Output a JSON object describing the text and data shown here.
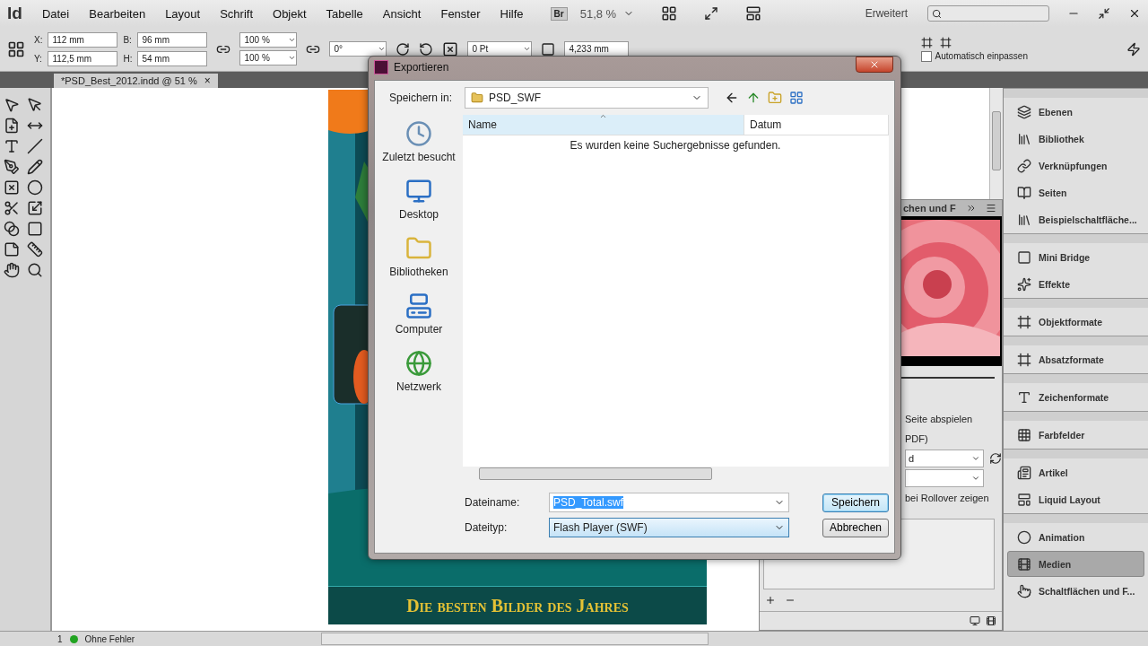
{
  "app": {
    "logo": "Id",
    "menu": [
      "Datei",
      "Bearbeiten",
      "Layout",
      "Schrift",
      "Objekt",
      "Tabelle",
      "Ansicht",
      "Fenster",
      "Hilfe"
    ],
    "bridge": "Br",
    "zoom": "51,8 %",
    "workspace": "Erweitert"
  },
  "control": {
    "fields": [
      {
        "label": "X:",
        "value": "112 mm"
      },
      {
        "label": "B:",
        "value": "96 mm"
      },
      {
        "label": "Y:",
        "value": "112,5 mm"
      },
      {
        "label": "H:",
        "value": "54 mm"
      }
    ],
    "scales": [
      "100 %",
      "100 %"
    ],
    "angle": "0°",
    "stroke": "0 Pt",
    "size": "4,233 mm",
    "autofit": {
      "label": "Automatisch einpassen",
      "checked": false
    }
  },
  "document_tab": {
    "title": "*PSD_Best_2012.indd @ 51 %",
    "close": "×"
  },
  "page": {
    "banner": "Die besten Bilder des Jahres"
  },
  "media_panel": {
    "tab": "chen und F",
    "options": [
      "Seite abspielen",
      "PDF)"
    ],
    "selects": [
      "d"
    ],
    "rollover": "bei Rollover zeigen"
  },
  "panel_groups": [
    {
      "items": [
        {
          "label": "Ebenen",
          "selected": false
        },
        {
          "label": "Bibliothek",
          "selected": false
        },
        {
          "label": "Verknüpfungen",
          "selected": false
        },
        {
          "label": "Seiten",
          "selected": false
        },
        {
          "label": "Beispielschaltfläche...",
          "selected": false
        }
      ]
    },
    {
      "items": [
        {
          "label": "Mini Bridge",
          "selected": false
        },
        {
          "label": "Effekte",
          "selected": false
        }
      ]
    },
    {
      "items": [
        {
          "label": "Objektformate",
          "selected": false
        }
      ]
    },
    {
      "items": [
        {
          "label": "Absatzformate",
          "selected": false
        }
      ]
    },
    {
      "items": [
        {
          "label": "Zeichenformate",
          "selected": false
        }
      ]
    },
    {
      "items": [
        {
          "label": "Farbfelder",
          "selected": false
        }
      ]
    },
    {
      "items": [
        {
          "label": "Artikel",
          "selected": false
        },
        {
          "label": "Liquid Layout",
          "selected": false
        }
      ]
    },
    {
      "items": [
        {
          "label": "Animation",
          "selected": false
        },
        {
          "label": "Medien",
          "selected": true
        },
        {
          "label": "Schaltflächen und F...",
          "selected": false
        }
      ]
    }
  ],
  "status_bar": {
    "page": "1",
    "preflight": "Ohne Fehler"
  },
  "dialog": {
    "title": "Exportieren",
    "save_in_label": "Speichern in:",
    "folder": "PSD_SWF",
    "places": [
      "Zuletzt besucht",
      "Desktop",
      "Bibliotheken",
      "Computer",
      "Netzwerk"
    ],
    "columns": [
      {
        "label": "Name",
        "sorted": true
      },
      {
        "label": "Datum",
        "sorted": false
      }
    ],
    "empty_message": "Es wurden keine Suchergebnisse gefunden.",
    "filename": {
      "label": "Dateiname:",
      "value": "PSD_Total.swf",
      "highlighted": true
    },
    "filetype": {
      "label": "Dateityp:",
      "value": "Flash Player (SWF)"
    },
    "buttons": [
      {
        "label": "Speichern",
        "default": true
      },
      {
        "label": "Abbrechen",
        "default": false
      }
    ]
  }
}
